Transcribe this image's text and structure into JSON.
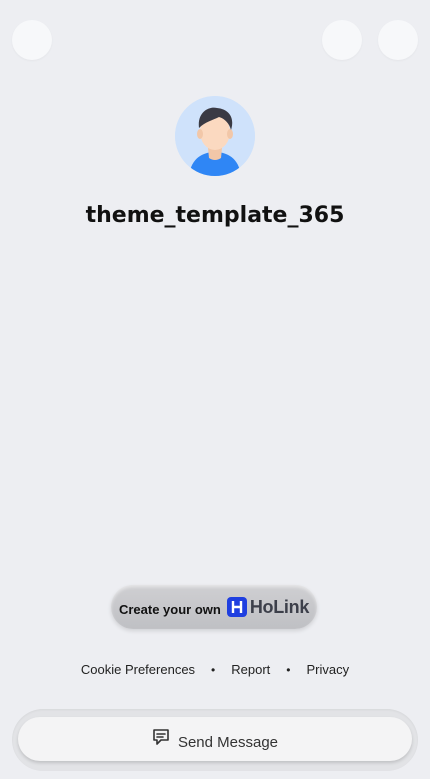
{
  "profile": {
    "username": "theme_template_365"
  },
  "cta": {
    "label": "Create your own",
    "brand": "HoLink"
  },
  "footer": {
    "links": [
      "Cookie Preferences",
      "Report",
      "Privacy"
    ]
  },
  "message_button": {
    "label": "Send Message",
    "icon": "chat-icon"
  },
  "colors": {
    "background": "#edeef2",
    "brand": "#1f3fe0"
  }
}
